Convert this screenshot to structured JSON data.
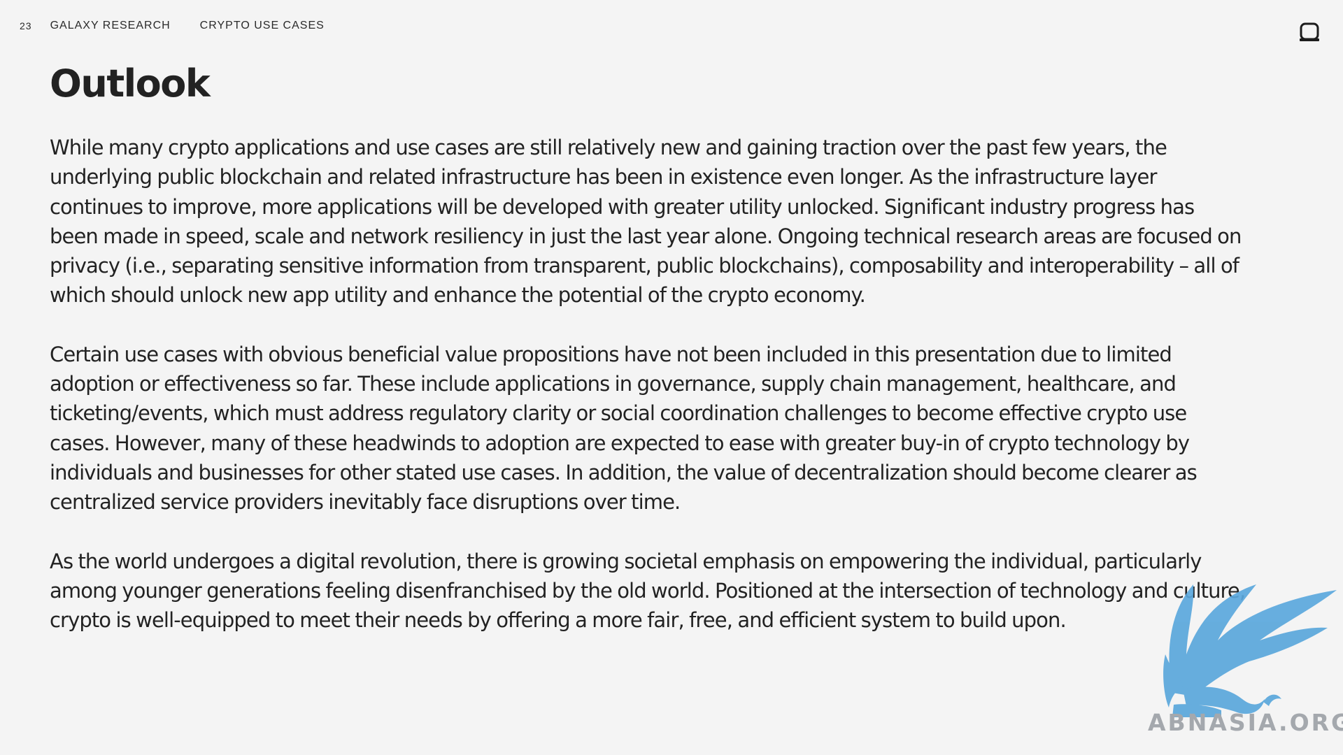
{
  "header": {
    "page_number": "23",
    "brand": "GALAXY RESEARCH",
    "section": "CRYPTO USE CASES"
  },
  "title": "Outlook",
  "paragraphs": [
    "While many crypto applications and use cases are still relatively new and gaining traction over the past few years, the underlying public blockchain and related infrastructure has been in existence even longer. As the infrastructure layer continues to improve, more applications will be developed with greater utility unlocked. Significant industry progress has been made in speed, scale and network resiliency in just the last year alone. Ongoing technical research areas are focused on privacy (i.e., separating sensitive information from transparent, public blockchains), composability and interoperability – all of which should unlock new app utility and enhance the potential of the crypto economy.",
    "Certain use cases with obvious beneficial value propositions have not been included in this presentation due to limited adoption or effectiveness so far. These include applications in governance, supply chain management, healthcare, and ticketing/events, which must address regulatory clarity or social coordination challenges to become effective crypto use cases. However, many of these headwinds to adoption are expected to ease with greater buy-in of crypto technology by individuals and businesses for other stated use cases.  In addition, the value of decentralization should become clearer as centralized service providers inevitably face disruptions over time.",
    "As the world undergoes a digital revolution, there is growing societal emphasis on empowering the individual, particularly among younger generations feeling disenfranchised by the old world. Positioned at the intersection of technology and culture, crypto is well-equipped to meet their needs by offering a more fair, free, and efficient system to build upon."
  ],
  "watermark": {
    "text": "ABNASIA.ORG",
    "color": "#5aa7dc"
  },
  "icons": {
    "logo": "galaxy-logo-icon",
    "watermark": "griffin-icon"
  }
}
